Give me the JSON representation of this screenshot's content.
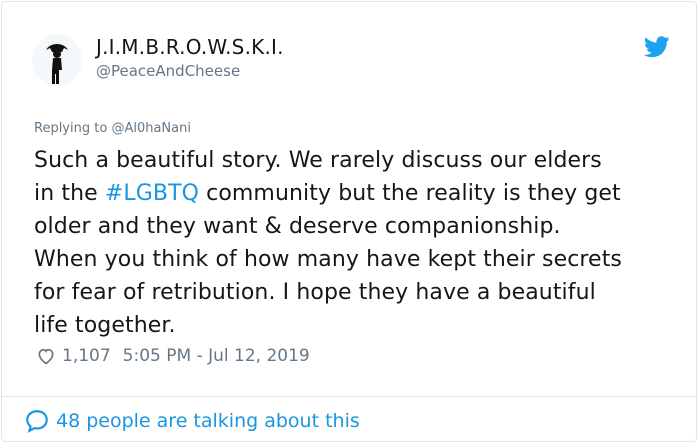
{
  "author": {
    "display_name": "J.I.M.B.R.O.W.S.K.I.",
    "handle": "@PeaceAndCheese"
  },
  "reply": {
    "prefix": "Replying to ",
    "target": "@Al0haNani"
  },
  "tweet": {
    "lines": [
      [
        "Such a beautiful story. We rarely discuss our elders"
      ],
      [
        "in the ",
        "#LGBTQ",
        " community but the reality is they get"
      ],
      [
        "older and they want & deserve companionship."
      ],
      [
        "When you think of how many have kept their secrets"
      ],
      [
        "for fear of retribution.  I hope they have a beautiful"
      ],
      [
        "life together."
      ]
    ],
    "hashtag": "#LGBTQ"
  },
  "meta": {
    "likes": "1,107",
    "timestamp": "5:05 PM - Jul 12, 2019"
  },
  "footer": {
    "talking": "48 people are talking about this"
  },
  "colors": {
    "link": "#1b95e0",
    "secondary": "#657786",
    "text": "#14171a",
    "border": "#e1e8ed"
  },
  "icons": {
    "avatar": "silhouette-avatar",
    "brand": "twitter-bird-icon",
    "like": "heart-outline-icon",
    "reply": "speech-bubble-icon"
  }
}
